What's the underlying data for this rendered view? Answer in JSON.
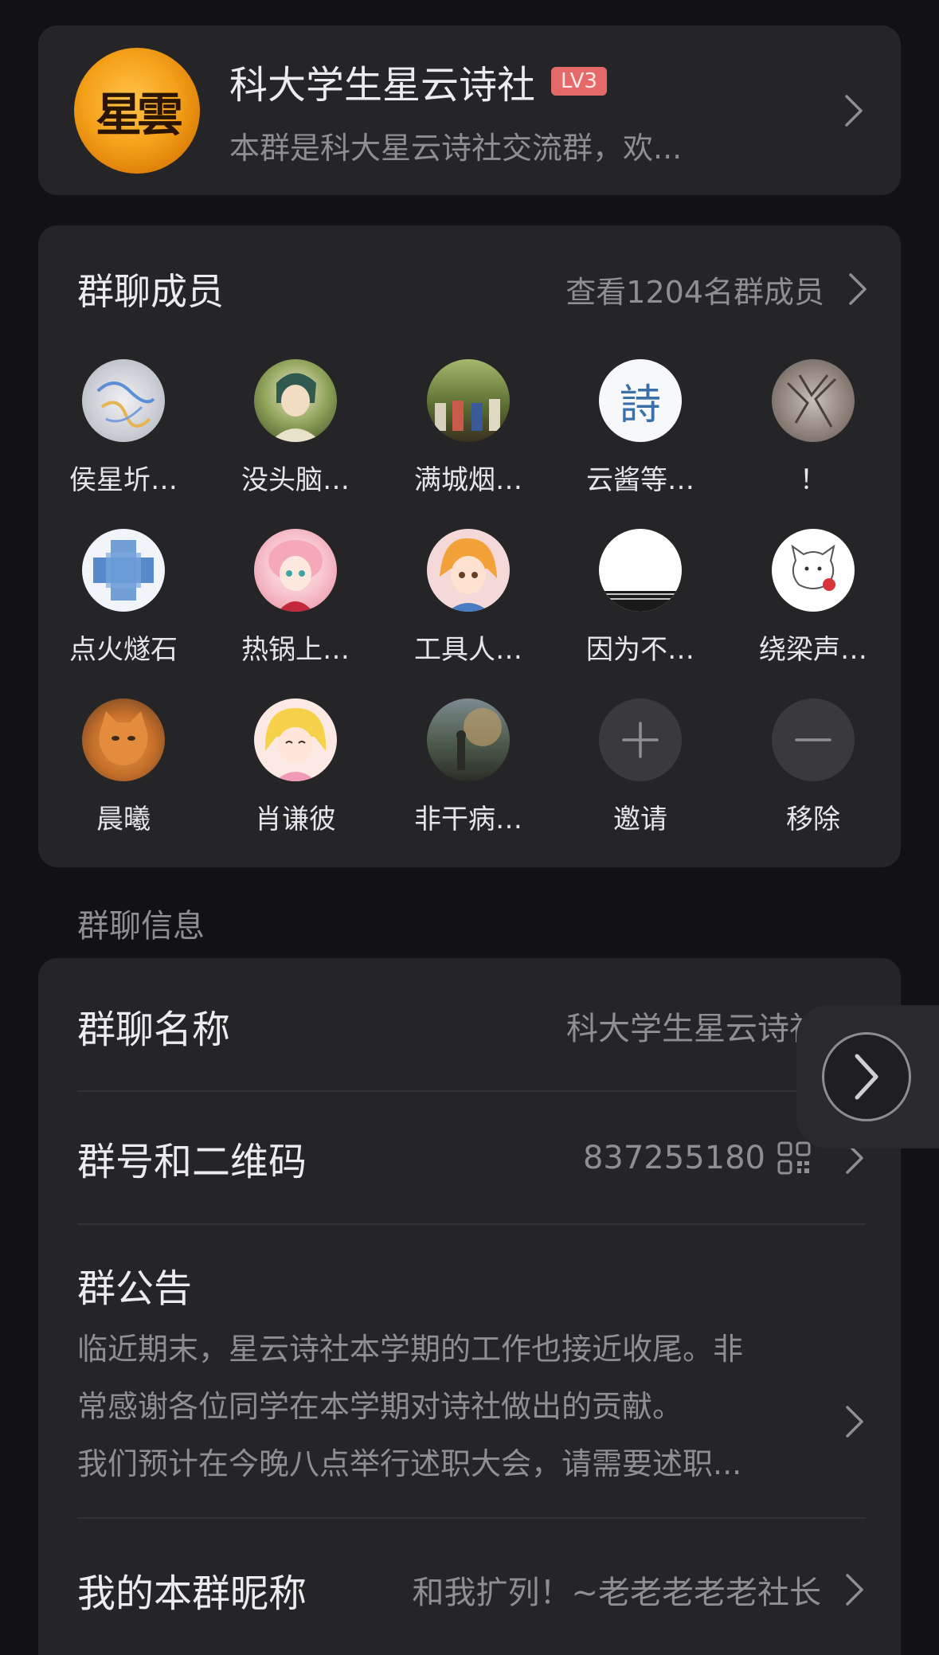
{
  "group": {
    "name": "科大学生星云诗社",
    "level": "LV3",
    "description": "本群是科大星云诗社交流群，欢...",
    "avatar_text": "星雲"
  },
  "members": {
    "title": "群聊成员",
    "view_all": "查看1204名群成员",
    "list": [
      {
        "name": "侯星圻…"
      },
      {
        "name": "没头脑…"
      },
      {
        "name": "满城烟…"
      },
      {
        "name": "云酱等…"
      },
      {
        "name": "！"
      },
      {
        "name": "点火燧石"
      },
      {
        "name": "热锅上…"
      },
      {
        "name": "工具人…"
      },
      {
        "name": "因为不…"
      },
      {
        "name": "绕梁声…"
      },
      {
        "name": "晨曦"
      },
      {
        "name": "肖谦彼"
      },
      {
        "name": "非干病…"
      }
    ],
    "invite_label": "邀请",
    "remove_label": "移除"
  },
  "section_label": "群聊信息",
  "info": {
    "name_label": "群聊名称",
    "name_value": "科大学生星云诗社",
    "number_label": "群号和二维码",
    "number_value": "837255180",
    "notice_label": "群公告",
    "notice_lines": [
      "临近期末，星云诗社本学期的工作也接近收尾。非",
      "常感谢各位同学在本学期对诗社做出的贡献。",
      "我们预计在今晚八点举行述职大会，请需要述职..."
    ],
    "nickname_label": "我的本群昵称",
    "nickname_value": "和我扩列！~老老老老老社长"
  },
  "colors": {
    "background": "#121214",
    "card": "#252527",
    "level_badge": "#e46a6a",
    "group_avatar": "#f5a21a"
  },
  "icons": [
    "chevron-right-icon",
    "qr-code-icon",
    "plus-icon",
    "minus-icon"
  ]
}
